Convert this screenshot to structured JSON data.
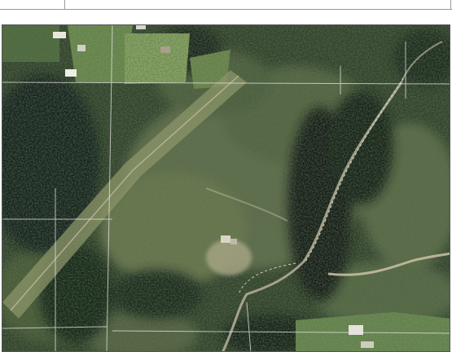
{
  "header": {
    "caption": ""
  },
  "map": {
    "kind": "aerial-orthophoto",
    "palette": {
      "forest_dark": "#1f2d1a",
      "forest": "#3b4b2a",
      "meadow": "#6f8450",
      "clearing": "#7d8a5a",
      "pasture": "#7fa15a",
      "road": "#b9b39a",
      "shadow": "#0f1a14",
      "parcel_line": "#e8e8e8"
    },
    "icons": [
      "house-icon",
      "barn-icon",
      "road-line"
    ]
  }
}
